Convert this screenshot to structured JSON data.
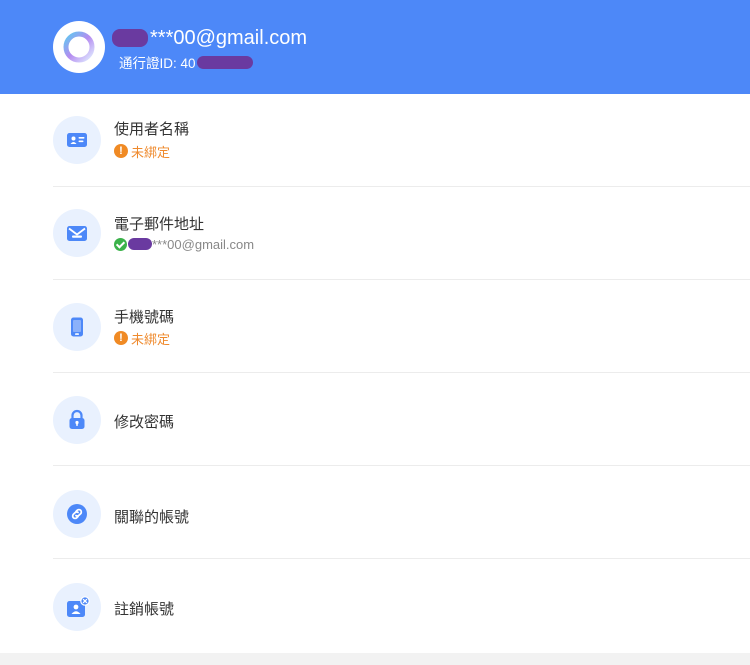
{
  "header": {
    "email_suffix": "***00@gmail.com",
    "id_label": "通行證ID: 40"
  },
  "items": [
    {
      "title": "使用者名稱",
      "status": "未綁定",
      "icon": "id-card-icon"
    },
    {
      "title": "電子郵件地址",
      "status": "***00@gmail.com",
      "icon": "mail-icon"
    },
    {
      "title": "手機號碼",
      "status": "未綁定",
      "icon": "phone-icon"
    },
    {
      "title": "修改密碼",
      "icon": "lock-icon"
    },
    {
      "title": "關聯的帳號",
      "icon": "link-icon"
    },
    {
      "title": "註銷帳號",
      "icon": "account-cancel-icon"
    }
  ],
  "colors": {
    "header_bg": "#4d88f8",
    "icon_bg": "#e9f1fe",
    "icon_blue": "#4d88f8",
    "warning": "#ef8a2d",
    "verified": "#3bb24a"
  }
}
